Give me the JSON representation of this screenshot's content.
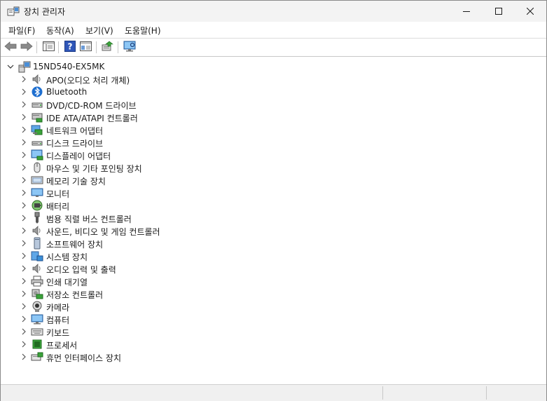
{
  "window": {
    "title": "장치 관리자",
    "minimize_icon": "minimize-icon",
    "maximize_icon": "maximize-icon",
    "close_icon": "close-icon"
  },
  "menu": {
    "items": [
      {
        "label": "파일(F)"
      },
      {
        "label": "동작(A)"
      },
      {
        "label": "보기(V)"
      },
      {
        "label": "도움말(H)"
      }
    ]
  },
  "toolbar": {
    "buttons": [
      "back-icon",
      "forward-icon",
      "show-hide-console-tree-icon",
      "help-icon",
      "properties-pane-icon",
      "update-driver-icon",
      "scan-hardware-icon"
    ]
  },
  "tree": {
    "root": {
      "label": "15ND540-EX5MK",
      "icon": "computer-icon"
    },
    "nodes": [
      {
        "label": "APO(오디오 처리 개체)",
        "icon": "speaker-icon"
      },
      {
        "label": "Bluetooth",
        "icon": "bluetooth-icon"
      },
      {
        "label": "DVD/CD-ROM 드라이브",
        "icon": "dvd-drive-icon"
      },
      {
        "label": "IDE ATA/ATAPI 컨트롤러",
        "icon": "ide-controller-icon"
      },
      {
        "label": "네트워크 어댑터",
        "icon": "network-adapter-icon"
      },
      {
        "label": "디스크 드라이브",
        "icon": "disk-drive-icon"
      },
      {
        "label": "디스플레이 어댑터",
        "icon": "display-adapter-icon"
      },
      {
        "label": "마우스 및 기타 포인팅 장치",
        "icon": "mouse-icon"
      },
      {
        "label": "메모리 기술 장치",
        "icon": "memory-device-icon"
      },
      {
        "label": "모니터",
        "icon": "monitor-icon"
      },
      {
        "label": "배터리",
        "icon": "battery-icon"
      },
      {
        "label": "범용 직렬 버스 컨트롤러",
        "icon": "usb-icon"
      },
      {
        "label": "사운드, 비디오 및 게임 컨트롤러",
        "icon": "sound-icon"
      },
      {
        "label": "소프트웨어 장치",
        "icon": "software-device-icon"
      },
      {
        "label": "시스템 장치",
        "icon": "system-device-icon"
      },
      {
        "label": "오디오 입력 및 출력",
        "icon": "audio-io-icon"
      },
      {
        "label": "인쇄 대기열",
        "icon": "printer-icon"
      },
      {
        "label": "저장소 컨트롤러",
        "icon": "storage-controller-icon"
      },
      {
        "label": "카메라",
        "icon": "camera-icon"
      },
      {
        "label": "컴퓨터",
        "icon": "computer-monitor-icon"
      },
      {
        "label": "키보드",
        "icon": "keyboard-icon"
      },
      {
        "label": "프로세서",
        "icon": "processor-icon"
      },
      {
        "label": "휴먼 인터페이스 장치",
        "icon": "hid-icon"
      }
    ]
  },
  "colors": {
    "titlebar_bg": "#f3f3f3",
    "window_bg": "#ffffff",
    "statusbar_bg": "#f0f0f0",
    "accent_blue": "#2b7fd4"
  }
}
